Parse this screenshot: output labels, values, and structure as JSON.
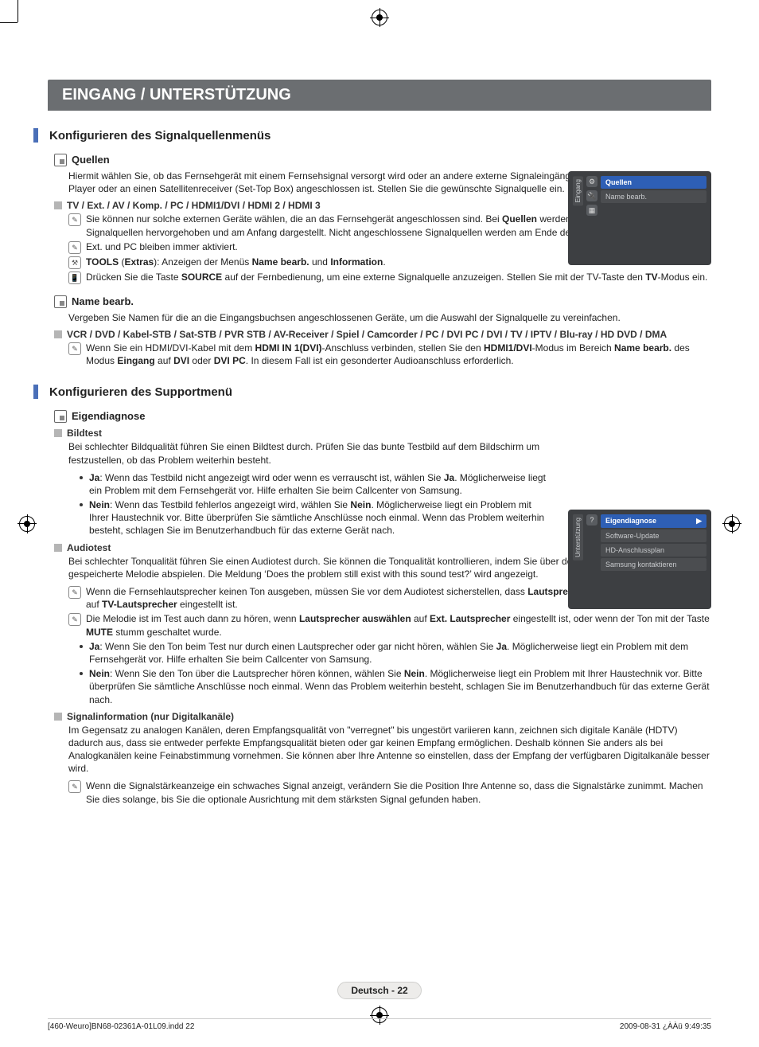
{
  "banner": "EINGANG / UNTERSTÜTZUNG",
  "section1_heading": "Konfigurieren des Signalquellenmenüs",
  "quellen": {
    "title": "Quellen",
    "desc": "Hiermit wählen Sie, ob das Fernsehgerät mit einem Fernsehsignal versorgt wird oder an andere externe Signaleingänge wie z. B. DVD- bzw. Blu-ray-Player oder an einen Satellitenreceiver (Set-Top Box) angeschlossen ist. Stellen Sie die gewünschte Signalquelle ein.",
    "inputs_title": "TV / Ext. / AV / Komp. / PC / HDMI1/DVI / HDMI 2 / HDMI 3",
    "note1_a": "Sie können nur solche externen Geräte wählen, die an das Fernsehgerät angeschlossen sind. Bei ",
    "note1_b": "Quellen",
    "note1_c": " werden die angeschlossenen Signalquellen hervorgehoben und am Anfang dargestellt. Nicht angeschlossene Signalquellen werden am Ende der Liste dargestellt.",
    "note2": "Ext. und PC bleiben immer aktiviert.",
    "note3_a": "TOOLS",
    "note3_b": " (",
    "note3_c": "Extras",
    "note3_d": "): Anzeigen der Menüs ",
    "note3_e": "Name bearb.",
    "note3_f": " und ",
    "note3_g": "Information",
    "note3_h": ".",
    "note4_a": "Drücken Sie die Taste ",
    "note4_b": "SOURCE",
    "note4_c": " auf der Fernbedienung, um eine externe Signalquelle anzuzeigen. Stellen Sie mit der TV-Taste den ",
    "note4_d": "TV",
    "note4_e": "-Modus ein."
  },
  "namebearb": {
    "title": "Name bearb.",
    "desc": "Vergeben Sie Namen für die an die Eingangsbuchsen angeschlossenen Geräte, um die Auswahl der Signalquelle zu vereinfachen.",
    "list_title": "VCR / DVD / Kabel-STB / Sat-STB / PVR STB / AV-Receiver / Spiel / Camcorder / PC / DVI PC / DVI / TV / IPTV / Blu-ray / HD DVD / DMA",
    "note_a": "Wenn Sie ein HDMI/DVI-Kabel mit dem ",
    "note_b": "HDMI IN 1(DVI)",
    "note_c": "-Anschluss verbinden, stellen Sie den ",
    "note_d": "HDMI1/DVI",
    "note_e": "-Modus im Bereich ",
    "note_f": "Name bearb.",
    "note_g": " des Modus ",
    "note_h": "Eingang",
    "note_i": " auf ",
    "note_j": "DVI",
    "note_k": " oder ",
    "note_l": "DVI PC",
    "note_m": ". In diesem Fall ist ein gesonderter Audioanschluss erforderlich."
  },
  "section2_heading": "Konfigurieren des Supportmenü",
  "eigen": {
    "title": "Eigendiagnose",
    "bild_title": "Bildtest",
    "bild_desc": "Bei schlechter Bildqualität führen Sie einen Bildtest durch. Prüfen Sie das bunte Testbild auf dem Bildschirm um festzustellen, ob das Problem weiterhin besteht.",
    "bild_ja_a": "Ja",
    "bild_ja_b": ": Wenn das Testbild nicht angezeigt wird oder wenn es verrauscht ist, wählen Sie ",
    "bild_ja_c": "Ja",
    "bild_ja_d": ". Möglicherweise liegt ein Problem mit dem Fernsehgerät vor. Hilfe erhalten Sie beim Callcenter von Samsung.",
    "bild_nein_a": "Nein",
    "bild_nein_b": ": Wenn das Testbild fehlerlos angezeigt wird, wählen Sie ",
    "bild_nein_c": "Nein",
    "bild_nein_d": ". Möglicherweise liegt ein Problem mit Ihrer Haustechnik vor. Bitte überprüfen Sie sämtliche Anschlüsse noch einmal. Wenn das Problem weiterhin besteht, schlagen Sie im Benutzerhandbuch für das externe Gerät nach.",
    "audio_title": "Audiotest",
    "audio_desc": "Bei schlechter Tonqualität führen Sie einen Audiotest durch. Sie können die Tonqualität kontrollieren, indem Sie über den Fernseher ein im Gerät gespeicherte Melodie abspielen. Die Meldung ‘Does the problem still exist with this sound test?’ wird angezeigt.",
    "audio_n1_a": "Wenn die Fernsehlautsprecher keinen Ton ausgeben, müssen Sie vor dem Audiotest sicherstellen, dass ",
    "audio_n1_b": "Lautsprecher auswählen",
    "audio_n1_c": " im Audiomenü auf ",
    "audio_n1_d": "TV-Lautsprecher",
    "audio_n1_e": "  eingestellt ist.",
    "audio_n2_a": "Die Melodie ist im Test auch dann zu hören, wenn ",
    "audio_n2_b": "Lautsprecher auswählen",
    "audio_n2_c": " auf ",
    "audio_n2_d": "Ext. Lautsprecher",
    "audio_n2_e": " eingestellt ist, oder wenn der Ton mit der Taste ",
    "audio_n2_f": "MUTE",
    "audio_n2_g": " stumm geschaltet wurde.",
    "audio_ja_a": "Ja",
    "audio_ja_b": ": Wenn Sie den Ton beim Test nur durch einen Lautsprecher oder gar nicht hören, wählen Sie ",
    "audio_ja_c": "Ja",
    "audio_ja_d": ". Möglicherweise liegt ein Problem mit dem Fernsehgerät vor. Hilfe erhalten Sie beim Callcenter von Samsung.",
    "audio_nein_a": "Nein",
    "audio_nein_b": ": Wenn Sie den Ton über die Lautsprecher hören können, wählen Sie ",
    "audio_nein_c": "Nein",
    "audio_nein_d": ". Möglicherweise liegt ein Problem mit Ihrer Haustechnik vor. Bitte überprüfen Sie sämtliche Anschlüsse noch einmal. Wenn das Problem weiterhin besteht, schlagen Sie im Benutzerhandbuch für das externe Gerät nach.",
    "sig_title": "Signalinformation (nur Digitalkanäle)",
    "sig_desc": "Im Gegensatz zu analogen Kanälen, deren Empfangsqualität von \"verregnet\" bis ungestört variieren kann, zeichnen sich digitale Kanäle (HDTV) dadurch aus, dass sie entweder perfekte Empfangsqualität bieten oder gar keinen Empfang ermöglichen. Deshalb können Sie anders als bei Analogkanälen keine Feinabstimmung vornehmen. Sie können aber Ihre Antenne so einstellen, dass der Empfang der verfügbaren Digitalkanäle besser wird.",
    "sig_note": "Wenn die Signalstärkeanzeige ein schwaches Signal anzeigt, verändern Sie die Position Ihre Antenne so, dass die Signalstärke zunimmt. Machen Sie dies solange, bis Sie die optionale Ausrichtung mit dem stärksten Signal gefunden haben."
  },
  "osd1": {
    "tab": "Eingang",
    "row_sel": "Quellen",
    "row2": "Name bearb."
  },
  "osd2": {
    "tab": "Unterstützung",
    "row_sel": "Eigendiagnose",
    "row2": "Software-Update",
    "row3": "HD-Anschlussplan",
    "row4": "Samsung kontaktieren",
    "arrow": "▶"
  },
  "footer_page": "Deutsch - 22",
  "print_left": "[460-Weuro]BN68-02361A-01L09.indd   22",
  "print_right": "2009-08-31   ¿ÀÀü 9:49:35"
}
